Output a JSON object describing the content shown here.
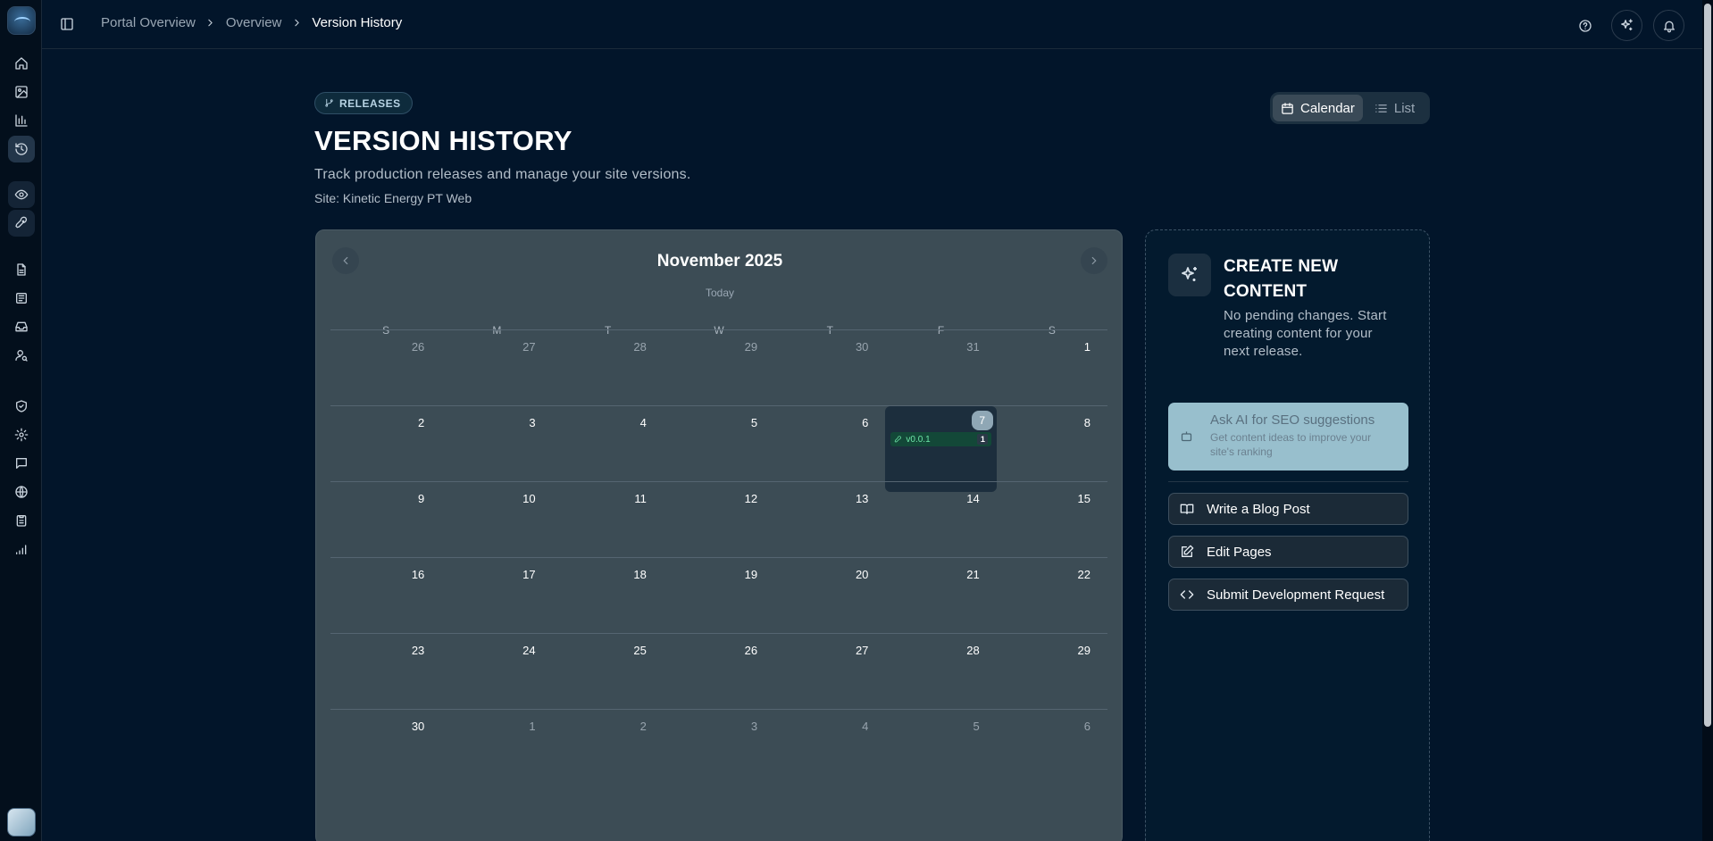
{
  "app": {
    "logo_icon": "portal-logo",
    "sidebar_icons": [
      "home-icon",
      "image-icon",
      "bar-chart-icon",
      "history-icon",
      "eye-icon",
      "rocket-icon",
      "file-icon",
      "newspaper-icon",
      "inbox-icon",
      "user-search-icon",
      "shield-icon",
      "gear-icon",
      "message-icon",
      "globe-icon",
      "clipboard-icon",
      "signal-icon"
    ],
    "active_sidebar_item": "history-icon"
  },
  "header": {
    "breadcrumb": [
      "Portal Overview",
      "Overview",
      "Version History"
    ],
    "icons": [
      "help-icon",
      "sparkles-icon",
      "bell-icon"
    ]
  },
  "page": {
    "badge": "RELEASES",
    "title": "VERSION HISTORY",
    "description": "Track production releases and manage your site versions.",
    "site": "Site: Kinetic Energy PT Web",
    "view_toggle": {
      "calendar": "Calendar",
      "list": "List",
      "active": "Calendar"
    }
  },
  "calendar": {
    "month": "November 2025",
    "today_label": "Today",
    "weekdays": [
      "S",
      "M",
      "T",
      "W",
      "T",
      "F",
      "S"
    ],
    "weeks": [
      [
        {
          "d": "26",
          "m": true
        },
        {
          "d": "27",
          "m": true
        },
        {
          "d": "28",
          "m": true
        },
        {
          "d": "29",
          "m": true
        },
        {
          "d": "30",
          "m": true
        },
        {
          "d": "31",
          "m": true
        },
        {
          "d": "1"
        }
      ],
      [
        {
          "d": "2"
        },
        {
          "d": "3"
        },
        {
          "d": "4"
        },
        {
          "d": "5"
        },
        {
          "d": "6"
        },
        {
          "d": "7",
          "today": true,
          "release": "v0.0.1",
          "count": "1"
        },
        {
          "d": "8"
        }
      ],
      [
        {
          "d": "9"
        },
        {
          "d": "10"
        },
        {
          "d": "11"
        },
        {
          "d": "12"
        },
        {
          "d": "13"
        },
        {
          "d": "14"
        },
        {
          "d": "15"
        }
      ],
      [
        {
          "d": "16"
        },
        {
          "d": "17"
        },
        {
          "d": "18"
        },
        {
          "d": "19"
        },
        {
          "d": "20"
        },
        {
          "d": "21"
        },
        {
          "d": "22"
        }
      ],
      [
        {
          "d": "23"
        },
        {
          "d": "24"
        },
        {
          "d": "25"
        },
        {
          "d": "26"
        },
        {
          "d": "27"
        },
        {
          "d": "28"
        },
        {
          "d": "29"
        }
      ],
      [
        {
          "d": "30"
        },
        {
          "d": "1",
          "m": true
        },
        {
          "d": "2",
          "m": true
        },
        {
          "d": "3",
          "m": true
        },
        {
          "d": "4",
          "m": true
        },
        {
          "d": "5",
          "m": true
        },
        {
          "d": "6",
          "m": true
        }
      ]
    ]
  },
  "panel": {
    "title": "CREATE NEW CONTENT",
    "description": "No pending changes. Start creating content for your next release.",
    "ai": {
      "title": "Ask AI for SEO suggestions",
      "subtitle": "Get content ideas to improve your site's ranking"
    },
    "actions": [
      "Write a Blog Post",
      "Edit Pages",
      "Submit Development Request"
    ]
  },
  "colors": {
    "background": "#02152a",
    "accent": "#98bfcd",
    "release": "#6ee7a8"
  }
}
